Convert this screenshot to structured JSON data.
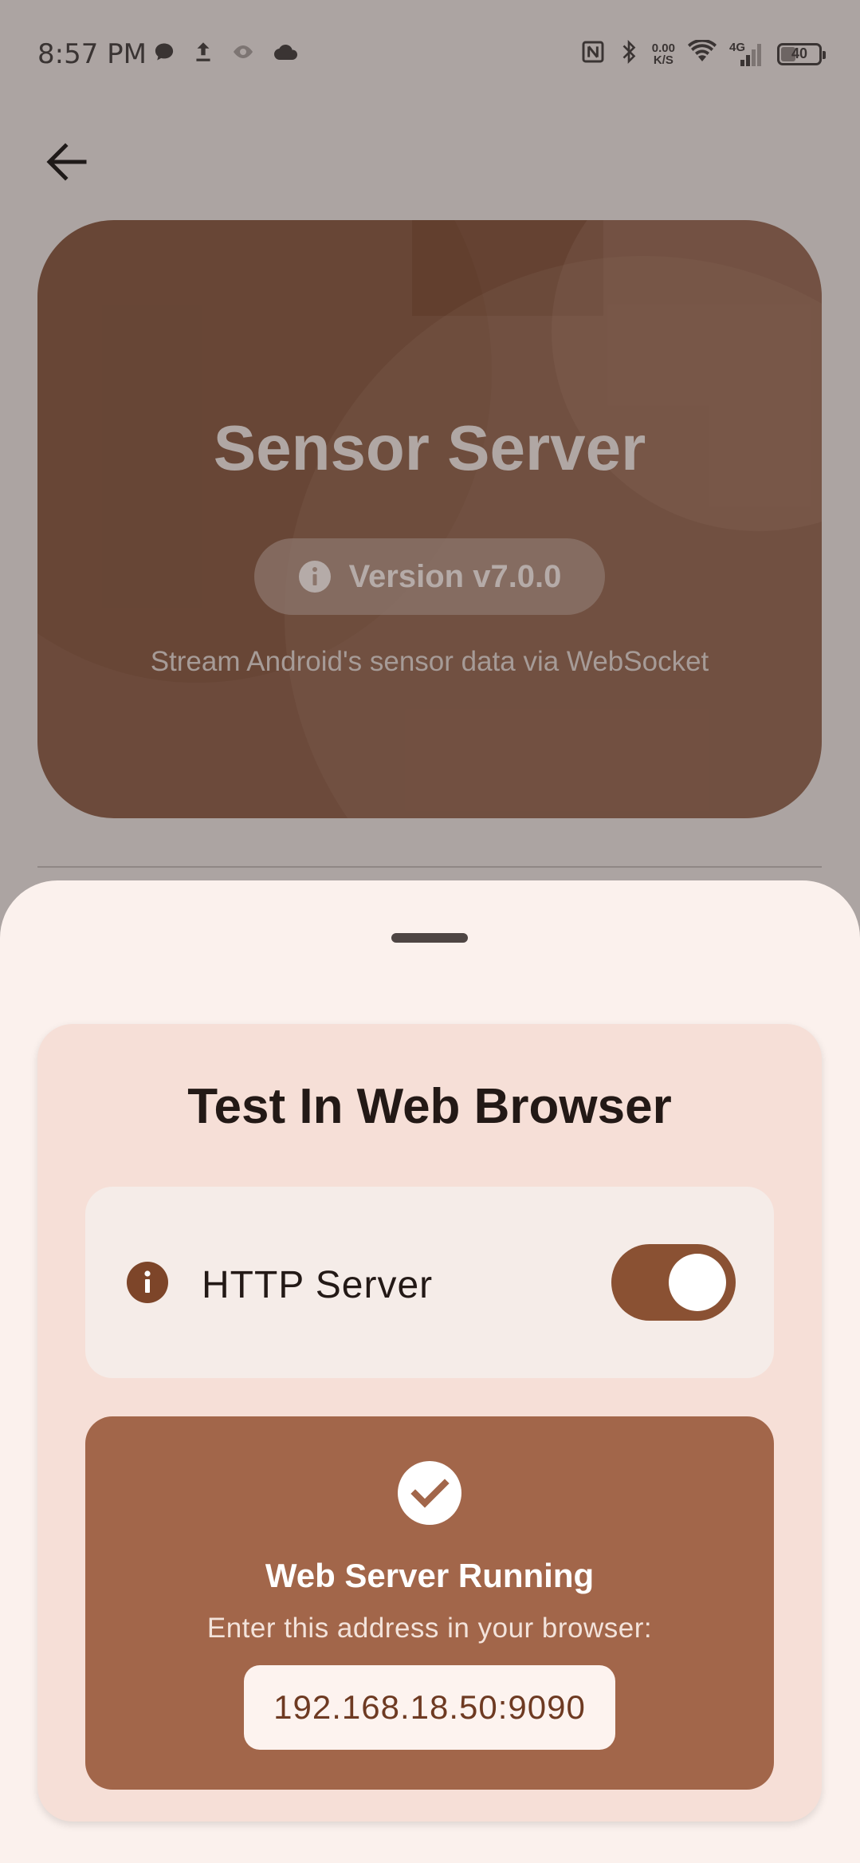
{
  "status_bar": {
    "time": "8:57 PM",
    "net_speed_value": "0.00",
    "net_speed_unit": "K/S",
    "network_type": "4G",
    "battery_level": "40",
    "battery_fraction": 0.4,
    "left_icons": [
      "chat-bubble-icon",
      "upload-icon",
      "eye-icon",
      "cloud-icon"
    ],
    "right_icons": [
      "nfc-icon",
      "bluetooth-icon",
      "net-speed",
      "wifi-icon",
      "cellular-4g-icon",
      "battery-icon"
    ]
  },
  "nav": {
    "back_icon": "arrow-back-icon"
  },
  "hero": {
    "title": "Sensor Server",
    "version": "Version v7.0.0",
    "subtitle": "Stream Android's sensor data via WebSocket"
  },
  "sheet": {
    "card_title": "Test In Web Browser",
    "http_server_label": "HTTP Server",
    "http_server_enabled": true,
    "status_title": "Web Server Running",
    "status_hint": "Enter this address in your browser:",
    "address": "192.168.18.50:9090"
  },
  "colors": {
    "scrim": "#aca4a2",
    "hero_card": "#6c4a3b",
    "sheet_background": "#fbf1ed",
    "card_background": "#f6dfd7",
    "toggle_on": "#8a5133",
    "status_panel": "#a2664a"
  }
}
